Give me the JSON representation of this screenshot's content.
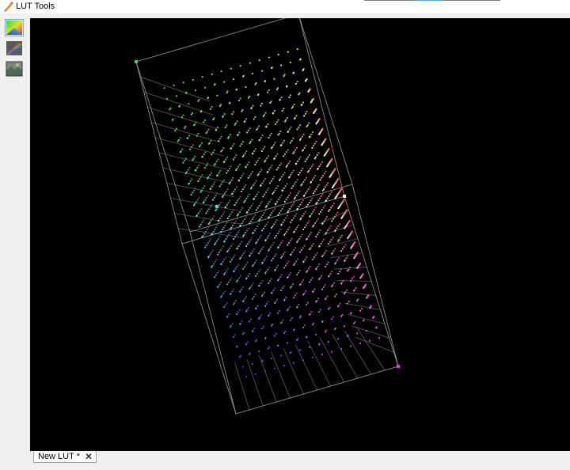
{
  "window": {
    "title": "LUT Tools",
    "app_icon": "pencil-icon"
  },
  "toolbar": {
    "tools": [
      {
        "id": "color-cube",
        "icon": "color-cube-icon",
        "active": true
      },
      {
        "id": "curves",
        "icon": "curves-icon",
        "active": false
      },
      {
        "id": "image-preview",
        "icon": "image-preview-icon",
        "active": false
      }
    ]
  },
  "viewer": {
    "background": "#000000",
    "corner_markers": [
      {
        "name": "green",
        "color": "#39d94a"
      },
      {
        "name": "yellow",
        "color": "#ffe13a"
      },
      {
        "name": "white",
        "color": "#ffffff"
      },
      {
        "name": "cyan",
        "color": "#39e0e0"
      },
      {
        "name": "magenta",
        "color": "#e040e0"
      }
    ]
  },
  "tabs": [
    {
      "label": "New LUT *",
      "close": "✕"
    }
  ]
}
